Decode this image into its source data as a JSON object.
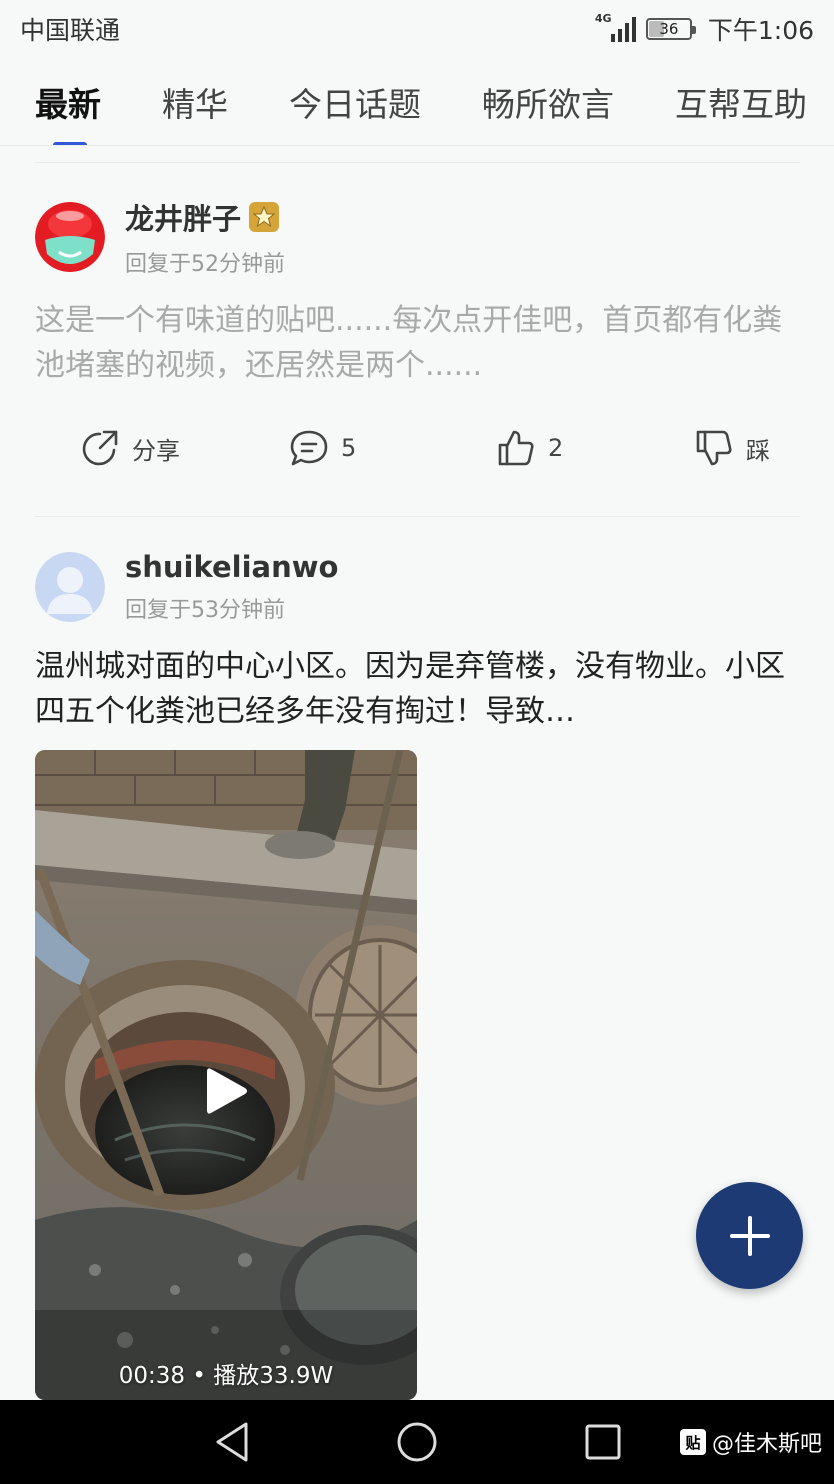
{
  "status_bar": {
    "carrier": "中国联通",
    "network": "4G",
    "battery": "36",
    "time": "下午1:06"
  },
  "tabs": [
    {
      "label": "最新",
      "active": true
    },
    {
      "label": "精华"
    },
    {
      "label": "今日话题"
    },
    {
      "label": "畅所欲言"
    },
    {
      "label": "互帮互助"
    }
  ],
  "posts": [
    {
      "author": "龙井胖子",
      "reply_time": "回复于52分钟前",
      "text": "这是一个有味道的贴吧......每次点开佳吧，首页都有化粪池堵塞的视频，还居然是两个......",
      "actions": {
        "share_label": "分享",
        "comments": "5",
        "likes": "2",
        "dislike_label": "踩"
      }
    },
    {
      "author": "shuikelianwo",
      "reply_time": "回复于53分钟前",
      "text": "温州城对面的中心小区。因为是弃管楼，没有物业。小区四五个化粪池已经多年没有掏过！导致…",
      "video": {
        "duration": "00:38",
        "plays": "播放33.9W",
        "separator": "•"
      }
    }
  ],
  "watermark": {
    "icon": "贴",
    "text": "@佳木斯吧"
  },
  "colors": {
    "accent": "#3456d9",
    "fab": "#1e3a75",
    "background": "#f6f9f8"
  }
}
